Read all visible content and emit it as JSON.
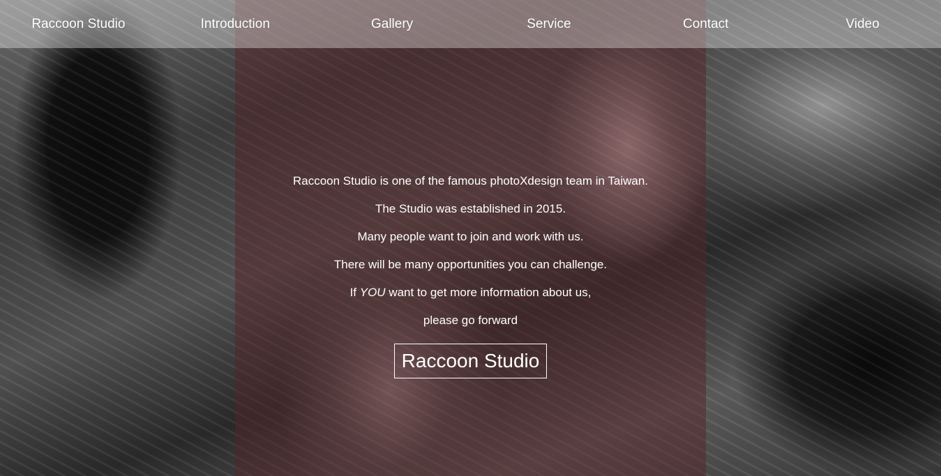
{
  "nav": {
    "items": [
      {
        "label": "Raccoon Studio"
      },
      {
        "label": "Introduction"
      },
      {
        "label": "Gallery"
      },
      {
        "label": "Service"
      },
      {
        "label": "Contact"
      },
      {
        "label": "Video"
      }
    ]
  },
  "intro": {
    "lines": [
      "Raccoon Studio is one of the famous photoXdesign team in Taiwan.",
      "The Studio was established in 2015.",
      "Many people want to join and work with us.",
      "There will be many opportunities you can challenge."
    ],
    "line5_prefix": "If ",
    "line5_emphasis": "YOU",
    "line5_suffix": " want to get more information about us,",
    "line6": "please go forward",
    "cta_label": "Raccoon Studio"
  },
  "colors": {
    "overlay": "#6e1e23",
    "text": "#ffffff"
  }
}
